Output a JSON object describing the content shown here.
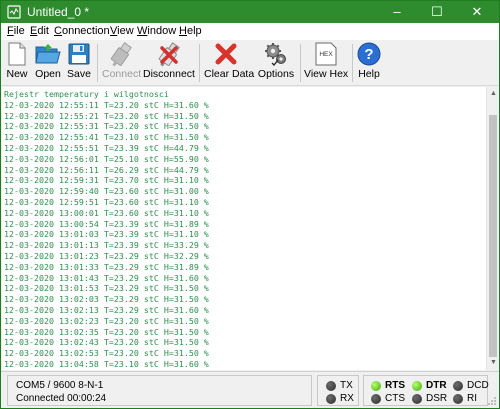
{
  "window": {
    "title": "Untitled_0 *",
    "controls": {
      "minimize": "–",
      "maximize": "☐",
      "close": "✕"
    }
  },
  "menu": [
    {
      "pre": "",
      "ul": "F",
      "post": "ile"
    },
    {
      "pre": "",
      "ul": "E",
      "post": "dit"
    },
    {
      "pre": "",
      "ul": "C",
      "post": "onnection"
    },
    {
      "pre": "",
      "ul": "V",
      "post": "iew"
    },
    {
      "pre": "",
      "ul": "W",
      "post": "indow"
    },
    {
      "pre": "",
      "ul": "H",
      "post": "elp"
    }
  ],
  "toolbar": {
    "new": "New",
    "open": "Open",
    "save": "Save",
    "connect": "Connect",
    "disconnect": "Disconnect",
    "clear": "Clear Data",
    "options": "Options",
    "view_hex": "View Hex",
    "hex_badge": "HEX",
    "help": "Help"
  },
  "terminal": {
    "lines": [
      "Rejestr temperatury i wilgotnosci",
      "12-03-2020 12:55:11 T=23.20 stC H=31.60 %",
      "12-03-2020 12:55:21 T=23.20 stC H=31.50 %",
      "12-03-2020 12:55:31 T=23.20 stC H=31.50 %",
      "12-03-2020 12:55:41 T=23.10 stC H=31.50 %",
      "12-03-2020 12:55:51 T=23.39 stC H=44.79 %",
      "12-03-2020 12:56:01 T=25.10 stC H=55.90 %",
      "12-03-2020 12:56:11 T=26.29 stC H=44.79 %",
      "12-03-2020 12:59:31 T=23.70 stC H=31.10 %",
      "12-03-2020 12:59:40 T=23.60 stC H=31.00 %",
      "12-03-2020 12:59:51 T=23.60 stC H=31.10 %",
      "12-03-2020 13:00:01 T=23.60 stC H=31.10 %",
      "12-03-2020 13:00:54 T=23.39 stC H=31.89 %",
      "12-03-2020 13:01:03 T=23.39 stC H=31.10 %",
      "12-03-2020 13:01:13 T=23.39 stC H=33.29 %",
      "12-03-2020 13:01:23 T=23.29 stC H=32.29 %",
      "12-03-2020 13:01:33 T=23.29 stC H=31.89 %",
      "12-03-2020 13:01:43 T=23.29 stC H=31.60 %",
      "12-03-2020 13:01:53 T=23.29 stC H=31.50 %",
      "12-03-2020 13:02:03 T=23.29 stC H=31.50 %",
      "12-03-2020 13:02:13 T=23.29 stC H=31.60 %",
      "12-03-2020 13:02:23 T=23.20 stC H=31.50 %",
      "12-03-2020 13:02:35 T=23.20 stC H=31.50 %",
      "12-03-2020 13:02:43 T=23.20 stC H=31.50 %",
      "12-03-2020 13:02:53 T=23.20 stC H=31.50 %",
      "12-03-2020 13:04:58 T=23.10 stC H=31.60 %"
    ],
    "text_color": "#2f8f4f"
  },
  "status": {
    "port": "COM5 / 9600 8-N-1",
    "connection": "Connected 00:00:24"
  },
  "leds": {
    "tx": {
      "label": "TX",
      "state": "off"
    },
    "rx": {
      "label": "RX",
      "state": "off"
    },
    "rts": {
      "label": "RTS",
      "state": "on"
    },
    "cts": {
      "label": "CTS",
      "state": "off"
    },
    "dtr": {
      "label": "DTR",
      "state": "on"
    },
    "dsr": {
      "label": "DSR",
      "state": "off"
    },
    "dcd": {
      "label": "DCD",
      "state": "off"
    },
    "ri": {
      "label": "RI",
      "state": "off"
    }
  },
  "colors": {
    "titlebar": "#2e8b2e",
    "led_on": "#3aa80c",
    "led_off": "#2e2e2e"
  }
}
